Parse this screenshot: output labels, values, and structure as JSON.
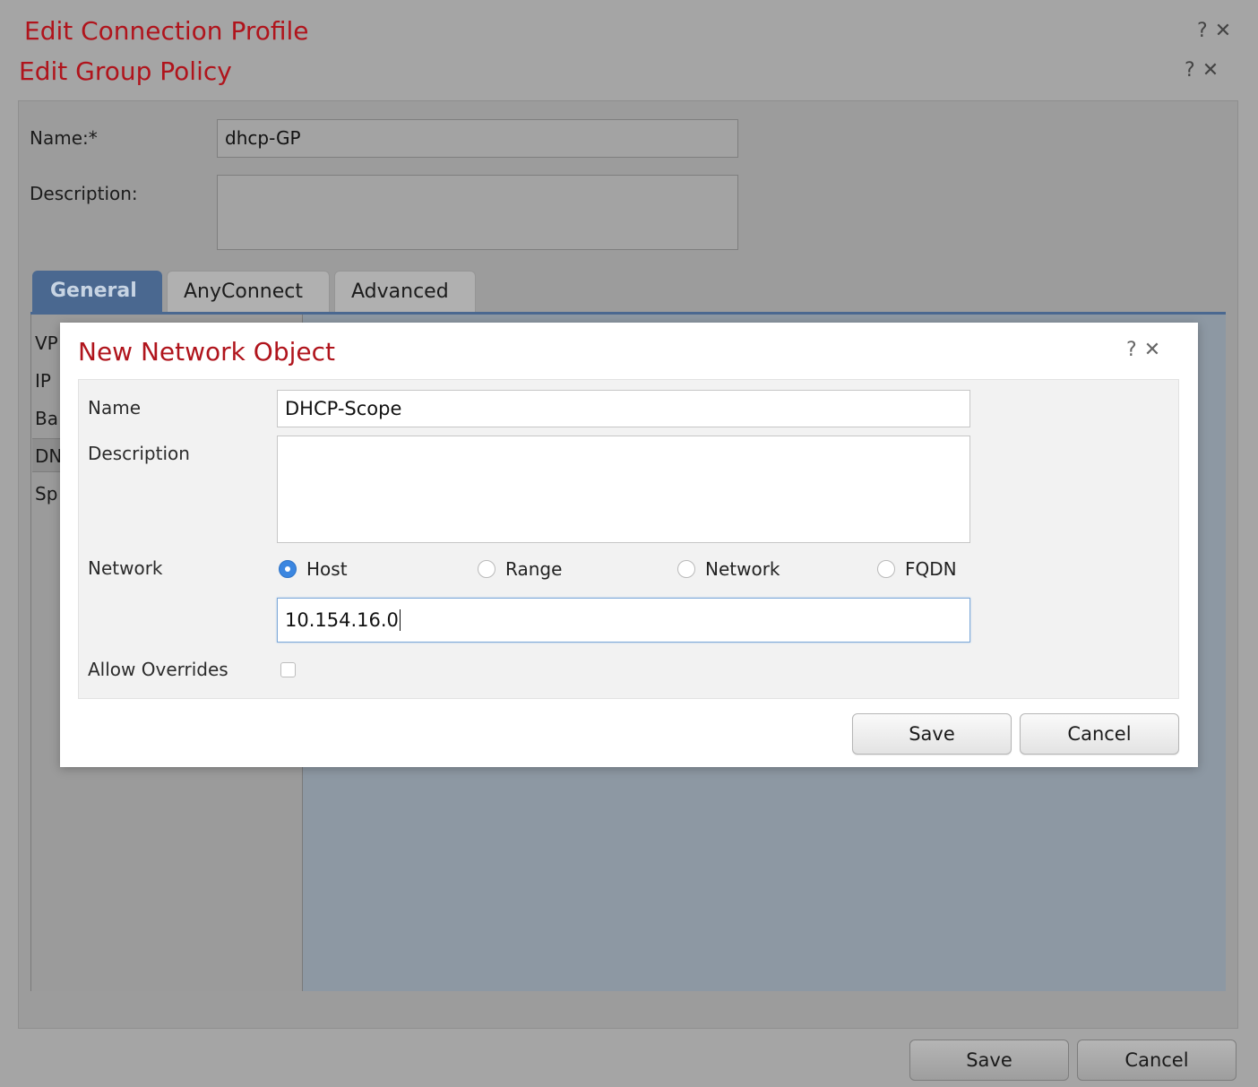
{
  "connection_profile": {
    "title": "Edit Connection Profile",
    "help": "?",
    "close": "✕"
  },
  "group_policy": {
    "title": "Edit Group Policy",
    "help": "?",
    "close": "✕",
    "name_label": "Name:*",
    "name_value": "dhcp-GP",
    "description_label": "Description:",
    "description_value": "",
    "tabs": [
      {
        "label": "General",
        "active": true
      },
      {
        "label": "AnyConnect",
        "active": false
      },
      {
        "label": "Advanced",
        "active": false
      }
    ],
    "side_items": [
      "VP",
      "IP",
      "Ba",
      "DN",
      "Sp"
    ],
    "save_label": "Save",
    "cancel_label": "Cancel"
  },
  "modal": {
    "title": "New Network Object",
    "help": "?",
    "close": "✕",
    "name_label": "Name",
    "name_value": "DHCP-Scope",
    "description_label": "Description",
    "description_value": "",
    "network_label": "Network",
    "network_options": [
      {
        "label": "Host",
        "selected": true
      },
      {
        "label": "Range",
        "selected": false
      },
      {
        "label": "Network",
        "selected": false
      },
      {
        "label": "FQDN",
        "selected": false
      }
    ],
    "network_value": "10.154.16.0",
    "allow_overrides_label": "Allow Overrides",
    "allow_overrides_checked": false,
    "save_label": "Save",
    "cancel_label": "Cancel"
  },
  "colors": {
    "title_red": "#b0141c",
    "tab_active": "#4a6890",
    "radio_selected": "#3b86e0"
  }
}
